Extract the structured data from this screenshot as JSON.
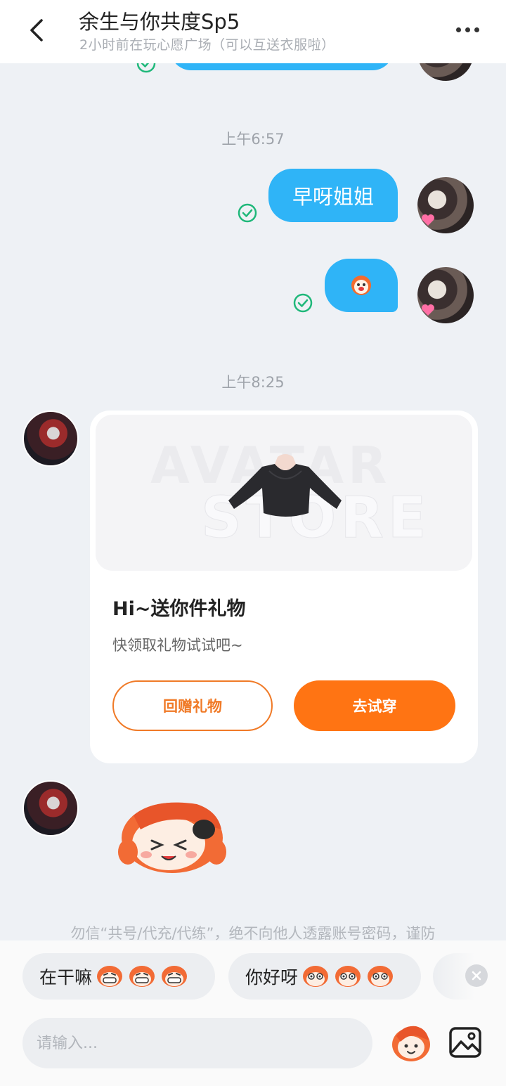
{
  "header": {
    "title": "余生与你共度Sp5",
    "subtitle": "2小时前在玩心愿广场（可以互送衣服啦）"
  },
  "messages": {
    "time1": "上午6:57",
    "bubble1_text": "早呀姐姐",
    "time2": "上午8:25"
  },
  "gift_card": {
    "watermark_line1": "AVATAR",
    "watermark_line2": "STORE",
    "title": "Hi~送你件礼物",
    "description": "快领取礼物试试吧~",
    "return_gift_label": "回赠礼物",
    "try_on_label": "去试穿"
  },
  "notice": "勿信“共号/代充/代练”，绝不向他人透露账号密码，谨防",
  "quick_replies": [
    {
      "text": "在干嘛",
      "emoji": "grin-face"
    },
    {
      "text": "你好呀",
      "emoji": "wide-eye-face"
    }
  ],
  "input": {
    "placeholder": "请输入..."
  },
  "colors": {
    "bubble": "#2fb4f7",
    "accent_orange": "#ff7413",
    "read_check": "#1fb87a"
  },
  "icons": [
    "back-arrow-icon",
    "more-dots-icon",
    "read-check-icon",
    "close-icon",
    "emoji-icon",
    "image-icon"
  ]
}
